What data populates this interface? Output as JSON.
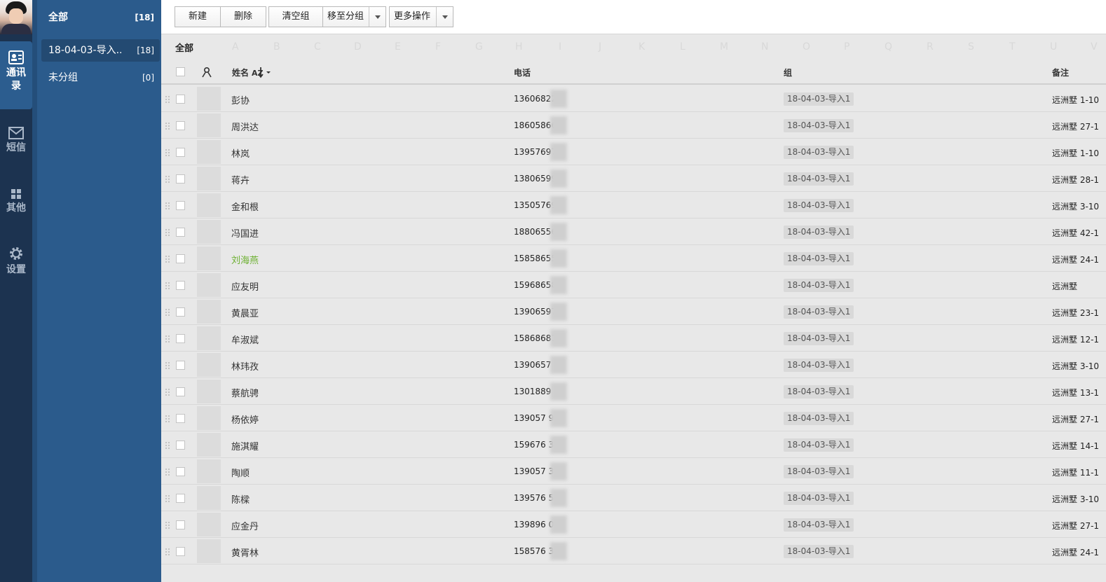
{
  "rail": {
    "items": [
      {
        "label": "通讯录",
        "icon": "contacts-icon",
        "active": true
      },
      {
        "label": "短信",
        "icon": "mail-icon"
      },
      {
        "label": "其他",
        "icon": "grid-icon"
      },
      {
        "label": "设置",
        "icon": "gear-icon"
      }
    ]
  },
  "groups": [
    {
      "label": "全部",
      "count": "[18]"
    },
    {
      "label": "18-04-03-导入..",
      "count": "[18]"
    },
    {
      "label": "未分组",
      "count": "[0]"
    }
  ],
  "toolbar": {
    "new": "新建",
    "delete": "删除",
    "clear_group": "清空组",
    "move_to_group": "移至分组",
    "more_actions": "更多操作"
  },
  "alpha_filter": {
    "all": "全部",
    "letters": [
      "A",
      "B",
      "C",
      "D",
      "E",
      "F",
      "G",
      "H",
      "I",
      "J",
      "K",
      "L",
      "M",
      "N",
      "O",
      "P",
      "Q",
      "R",
      "S",
      "T",
      "U",
      "V"
    ]
  },
  "table": {
    "headers": {
      "name": "姓名",
      "phone": "电话",
      "group": "组",
      "note": "备注"
    },
    "rows": [
      {
        "name": "彭协",
        "phone": "13606822",
        "group": "18-04-03-导入1",
        "note": "远洲墅 1-10"
      },
      {
        "name": "周洪达",
        "phone": "18605866",
        "group": "18-04-03-导入1",
        "note": "远洲墅 27-1"
      },
      {
        "name": "林岚",
        "phone": "13957697",
        "group": "18-04-03-导入1",
        "note": "远洲墅 1-10"
      },
      {
        "name": "蒋卉",
        "phone": "13806599",
        "group": "18-04-03-导入1",
        "note": "远洲墅 28-1"
      },
      {
        "name": "金和根",
        "phone": "13505769",
        "group": "18-04-03-导入1",
        "note": "远洲墅 3-10"
      },
      {
        "name": "冯国进",
        "phone": "18806556",
        "group": "18-04-03-导入1",
        "note": "远洲墅 42-1"
      },
      {
        "name": "刘海燕",
        "phone": "15858655",
        "group": "18-04-03-导入1",
        "note": "远洲墅 24-1",
        "highlight": true
      },
      {
        "name": "应友明",
        "phone": "15968658",
        "group": "18-04-03-导入1",
        "note": "远洲墅"
      },
      {
        "name": "黄晨亚",
        "phone": "13906597",
        "group": "18-04-03-导入1",
        "note": "远洲墅 23-1"
      },
      {
        "name": "牟淑斌",
        "phone": "15868681",
        "group": "18-04-03-导入1",
        "note": "远洲墅 12-1"
      },
      {
        "name": "林玮孜",
        "phone": "1390657",
        "group": "18-04-03-导入1",
        "note": "远洲墅 3-10"
      },
      {
        "name": "蔡航骋",
        "phone": "1301889 8",
        "group": "18-04-03-导入1",
        "note": "远洲墅 13-1"
      },
      {
        "name": "杨依婷",
        "phone": "139057 98",
        "group": "18-04-03-导入1",
        "note": "远洲墅 27-1"
      },
      {
        "name": "施淇耀",
        "phone": "159676 38",
        "group": "18-04-03-导入1",
        "note": "远洲墅 14-1"
      },
      {
        "name": "陶顺",
        "phone": "139057 33",
        "group": "18-04-03-导入1",
        "note": "远洲墅 11-1"
      },
      {
        "name": "陈樑",
        "phone": "139576 58",
        "group": "18-04-03-导入1",
        "note": "远洲墅 3-10"
      },
      {
        "name": "应金丹",
        "phone": "139896 02",
        "group": "18-04-03-导入1",
        "note": "远洲墅 27-1"
      },
      {
        "name": "黄胥林",
        "phone": "158576 38",
        "group": "18-04-03-导入1",
        "note": "远洲墅 24-1"
      }
    ]
  }
}
